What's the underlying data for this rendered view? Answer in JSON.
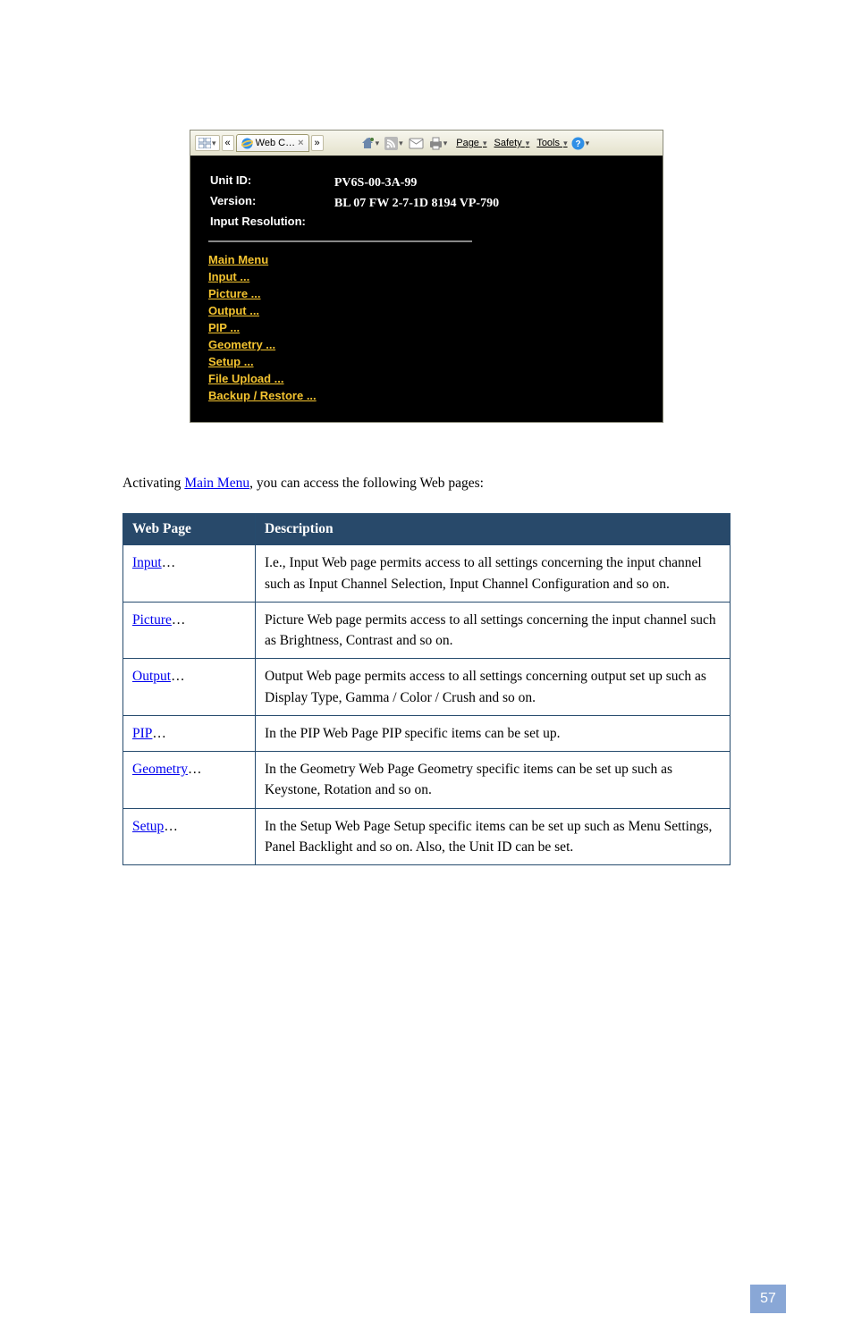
{
  "toolbar": {
    "back_glyph": "«",
    "forward_glyph": "»",
    "tab_label": "Web C…",
    "menus": {
      "page": "Page",
      "safety": "Safety",
      "tools": "Tools"
    }
  },
  "header": {
    "unit_id_key": "Unit ID:",
    "unit_id_val": "PV6S-00-3A-99",
    "version_key": "Version:",
    "version_val": "BL 07 FW 2-7-1D 8194 VP-790",
    "input_res_key": "Input Resolution:",
    "input_res_val": ""
  },
  "nav": {
    "main_menu": "Main Menu",
    "input": "Input ...",
    "picture": "Picture ...",
    "output": "Output ...",
    "pip": "PIP ...",
    "geometry": "Geometry ...",
    "setup": "Setup ...",
    "file_upload": "File Upload ...",
    "backup_restore": "Backup / Restore ..."
  },
  "para": {
    "before_link": "Activating ",
    "link": "Main Menu",
    "after_link": ", you can access the following Web pages:"
  },
  "table": {
    "head1": "Web Page",
    "head2": "Description",
    "rows": [
      {
        "label": "Input",
        "dots": "…",
        "desc": "I.e., Input Web page permits access to all settings concerning the input channel such as Input Channel Selection, Input Channel Configuration and so on."
      },
      {
        "label": "Picture",
        "dots": "…",
        "desc": "Picture Web page permits access to all settings concerning the input channel such as Brightness, Contrast and so on."
      },
      {
        "label": "Output",
        "dots": "…",
        "desc": "Output Web page permits access to all settings concerning output set up such as Display Type, Gamma / Color / Crush and so on."
      },
      {
        "label": "PIP",
        "dots": "…",
        "desc": "In the PIP Web Page PIP specific items can be set up."
      },
      {
        "label": "Geometry",
        "dots": "…",
        "desc": "In the Geometry Web Page Geometry specific items can be set up such as Keystone, Rotation and so on."
      },
      {
        "label": "Setup",
        "dots": "…",
        "desc": "In the Setup Web Page Setup specific items can be set up such as Menu Settings, Panel Backlight and so on. Also, the Unit ID can be set."
      }
    ]
  },
  "page_number": "57"
}
